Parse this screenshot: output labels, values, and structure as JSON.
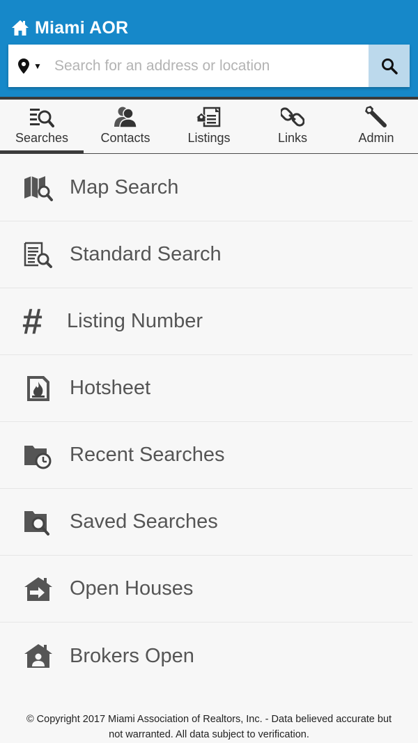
{
  "header": {
    "title": "Miami AOR",
    "home_icon": "home-icon",
    "bg_color": "#1688c9"
  },
  "search": {
    "placeholder": "Search for an address or location",
    "location_icon": "map-pin-icon",
    "search_icon": "search-icon"
  },
  "tabs": [
    {
      "label": "Searches",
      "icon": "search-list-icon",
      "active": true
    },
    {
      "label": "Contacts",
      "icon": "contacts-icon",
      "active": false
    },
    {
      "label": "Listings",
      "icon": "listings-icon",
      "active": false
    },
    {
      "label": "Links",
      "icon": "chain-link-icon",
      "active": false
    },
    {
      "label": "Admin",
      "icon": "wrench-icon",
      "active": false
    }
  ],
  "menu": [
    {
      "label": "Map Search",
      "icon": "map-search-icon"
    },
    {
      "label": "Standard Search",
      "icon": "document-search-icon"
    },
    {
      "label": "Listing Number",
      "icon": "hash-icon"
    },
    {
      "label": "Hotsheet",
      "icon": "flame-document-icon"
    },
    {
      "label": "Recent Searches",
      "icon": "folder-clock-icon"
    },
    {
      "label": "Saved Searches",
      "icon": "folder-search-icon"
    },
    {
      "label": "Open Houses",
      "icon": "house-arrow-icon"
    },
    {
      "label": "Brokers Open",
      "icon": "house-person-icon"
    }
  ],
  "footer": {
    "line1": "© Copyright 2017 Miami Association of Realtors, Inc. - Data believed accurate but",
    "line2": "not warranted. All data subject to verification."
  }
}
